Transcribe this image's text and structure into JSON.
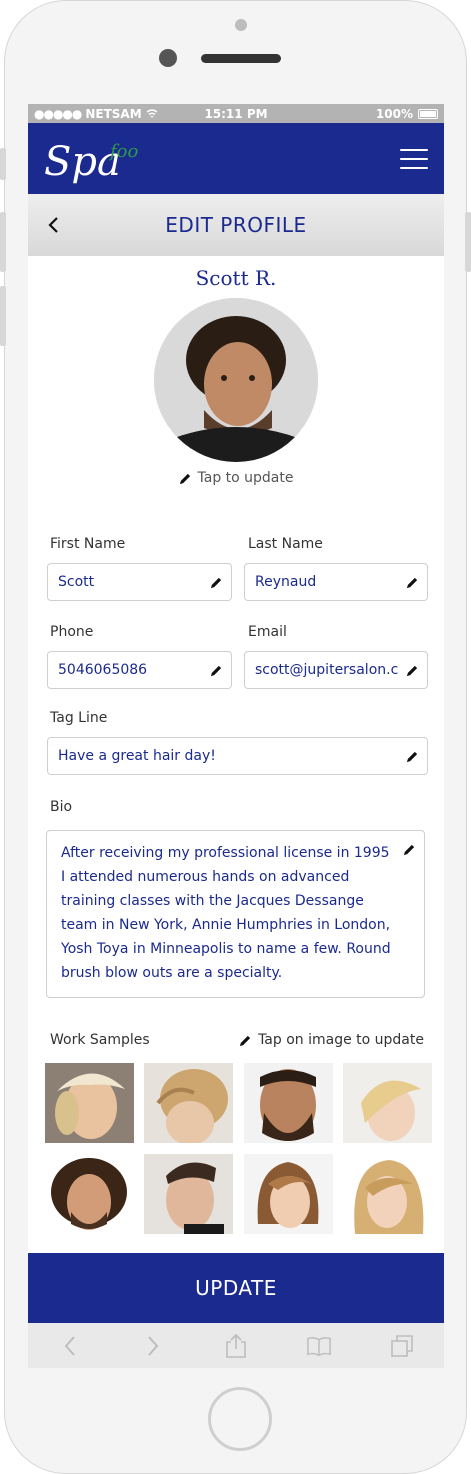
{
  "status_bar": {
    "carrier": "NETSAM",
    "time": "15:11 PM",
    "battery": "100%"
  },
  "app": {
    "logo_main": "Spa",
    "logo_accent": "foo"
  },
  "header": {
    "title": "EDIT PROFILE"
  },
  "profile": {
    "name": "Scott R.",
    "tap_to_update": "Tap to update"
  },
  "form": {
    "first_name": {
      "label": "First Name",
      "value": "Scott"
    },
    "last_name": {
      "label": "Last Name",
      "value": "Reynaud"
    },
    "phone": {
      "label": "Phone",
      "value": "5046065086"
    },
    "email": {
      "label": "Email",
      "value": "scott@jupitersalon.c"
    },
    "tag_line": {
      "label": "Tag Line",
      "value": "Have a great hair day!"
    },
    "bio": {
      "label": "Bio",
      "value": "After receiving my professional license in 1995 I attended numerous hands on advanced training classes with the Jacques Dessange  team in New York, Annie Humphries in London, Yosh Toya in Minneapolis to name a few. Round brush blow outs are a specialty."
    }
  },
  "work_samples": {
    "label": "Work Samples",
    "hint": "Tap on image to update"
  },
  "actions": {
    "update_label": "UPDATE"
  },
  "colors": {
    "brand_navy": "#1b2a8e",
    "logo_accent_green": "#2e9a4a"
  }
}
